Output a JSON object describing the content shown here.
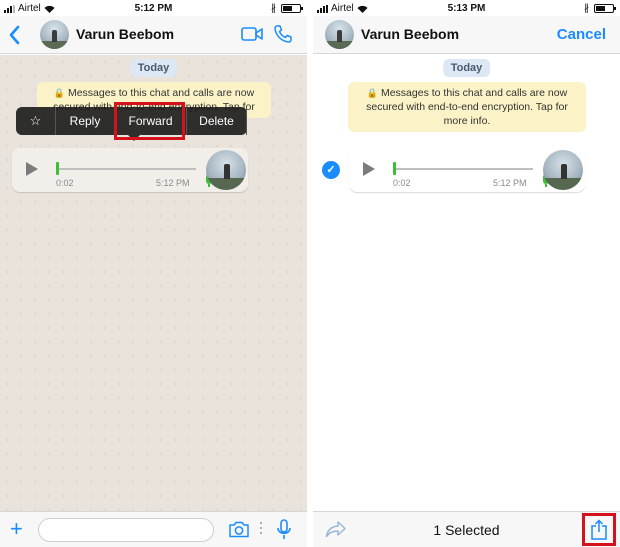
{
  "status": {
    "carrier": "Airtel",
    "left_time": "5:12 PM",
    "right_time": "5:13 PM"
  },
  "contact": {
    "name": "Varun Beebom"
  },
  "chat": {
    "date_label": "Today",
    "system_message_left": "Messages to this chat and calls are now secured with end-to-end encryption. Tap for",
    "system_message_right": "Messages to this chat and calls are now secured with end-to-end encryption. Tap for more info."
  },
  "context_menu": {
    "star": "☆",
    "reply": "Reply",
    "forward": "Forward",
    "delete": "Delete"
  },
  "voice_message": {
    "duration": "0:02",
    "time": "5:12 PM"
  },
  "nav_right": {
    "cancel": "Cancel"
  },
  "bottom_left": {
    "input_placeholder": ""
  },
  "bottom_right": {
    "selected_text": "1 Selected"
  },
  "colors": {
    "accent": "#1a8cff",
    "highlight": "#d4121b",
    "system_msg_bg": "#fbf3c7",
    "voice_green": "#3bbf3b"
  },
  "icons": [
    "back-chevron-icon",
    "video-call-icon",
    "phone-icon",
    "lock-icon",
    "play-icon",
    "mic-icon",
    "plus-icon",
    "camera-icon",
    "forward-arrow-icon",
    "share-icon",
    "checkmark-icon"
  ]
}
